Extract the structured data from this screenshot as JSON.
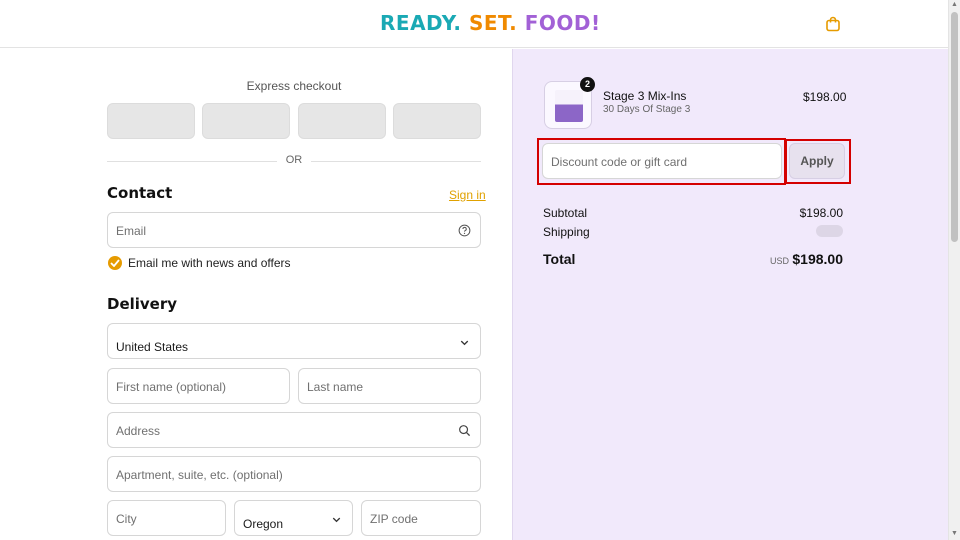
{
  "header": {
    "logo": {
      "part1": "READY.",
      "part2": "SET.",
      "part3": "FOOD!"
    },
    "colors": {
      "part1": "#1aa9b4",
      "part2": "#f08a00",
      "part3": "#a261d6"
    },
    "cart_icon": "shopping-bag-icon"
  },
  "express": {
    "label": "Express checkout",
    "divider_text": "OR"
  },
  "contact": {
    "title": "Contact",
    "sign_in": "Sign in",
    "email_placeholder": "Email",
    "email_help_icon": "help-circle-icon",
    "marketing_label": "Email me with news and offers",
    "marketing_checked": true
  },
  "delivery": {
    "title": "Delivery",
    "country_label": "Country/Region",
    "country_value": "United States",
    "first_name_placeholder": "First name (optional)",
    "last_name_placeholder": "Last name",
    "address_placeholder": "Address",
    "apartment_placeholder": "Apartment, suite, etc. (optional)",
    "city_placeholder": "City",
    "state_value": "Oregon",
    "zip_placeholder": "ZIP code"
  },
  "order": {
    "item": {
      "name": "Stage 3 Mix-Ins",
      "variant": "30 Days Of Stage 3",
      "price": "$198.00",
      "quantity": "2"
    },
    "discount_placeholder": "Discount code or gift card",
    "apply_label": "Apply",
    "subtotal_label": "Subtotal",
    "subtotal_value": "$198.00",
    "shipping_label": "Shipping",
    "total_label": "Total",
    "total_currency": "USD",
    "total_value": "$198.00"
  },
  "theme": {
    "accent": "#e69b00",
    "summary_bg": "#f1e9fb",
    "highlight": "#d40000"
  }
}
